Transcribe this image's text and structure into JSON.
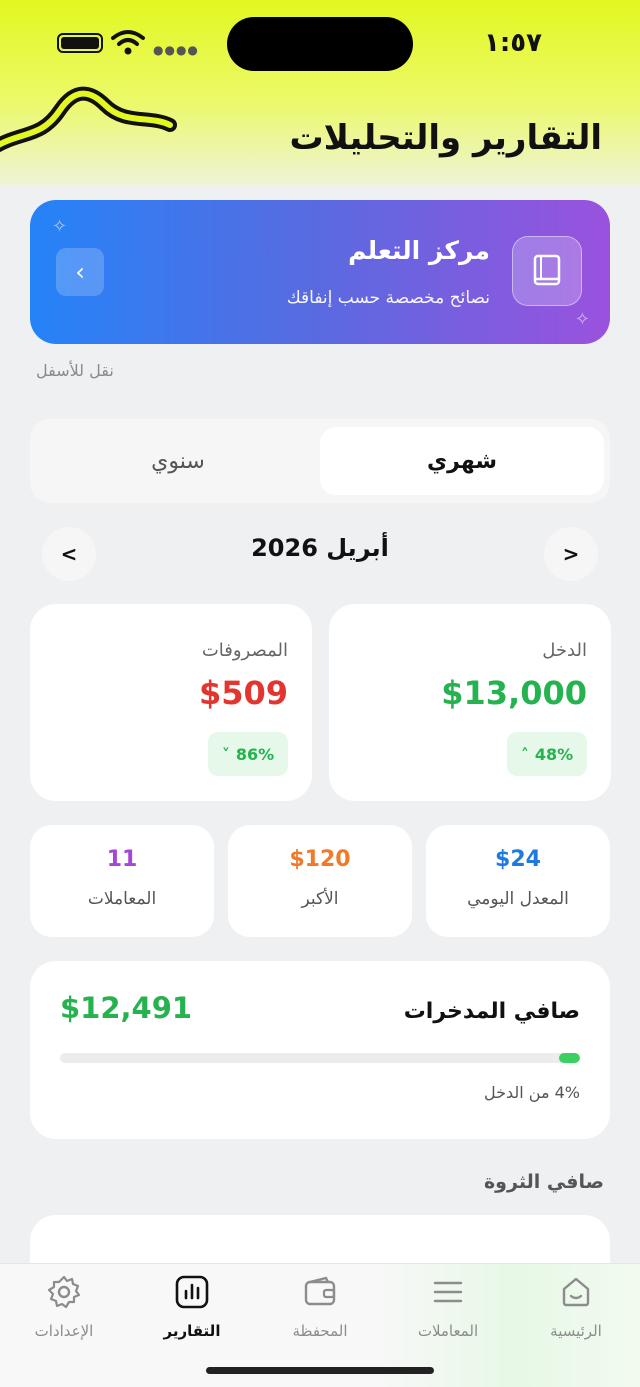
{
  "status_bar": {
    "time": "١:٥٧"
  },
  "page_title": "التقارير والتحليلات",
  "learning_card": {
    "title": "مركز التعلم",
    "subtitle": "نصائح مخصصة حسب إنفاقك"
  },
  "move_down_hint": "نقل للأسفل",
  "period_toggle": {
    "monthly": "شهري",
    "yearly": "سنوي",
    "selected": "monthly"
  },
  "month_nav": {
    "label": "أبريل 2026",
    "prev": "<",
    "next": ">"
  },
  "income": {
    "label": "الدخل",
    "value": "$13,000",
    "badge": "48%",
    "color": "#27b250"
  },
  "expenses": {
    "label": "المصروفات",
    "value": "$509",
    "badge": "86%",
    "color": "#e3342f"
  },
  "mini_stats": [
    {
      "label": "المعدل اليومي",
      "value": "$24",
      "color": "#1f7ae0"
    },
    {
      "label": "الأكبر",
      "value": "$120",
      "color": "#f07a2a"
    },
    {
      "label": "المعاملات",
      "value": "11",
      "color": "#a646d6"
    }
  ],
  "net_savings": {
    "title": "صافي المدخرات",
    "value": "$12,491",
    "note": "4% من الدخل",
    "progress": 0.04
  },
  "net_worth_heading": "صافي الثروة",
  "tabbar": [
    {
      "label": "الرئيسية",
      "icon": "home-icon",
      "active": false
    },
    {
      "label": "المعاملات",
      "icon": "list-icon",
      "active": false
    },
    {
      "label": "المحفظة",
      "icon": "wallet-icon",
      "active": false
    },
    {
      "label": "التقارير",
      "icon": "chart-icon",
      "active": true
    },
    {
      "label": "الإعدادات",
      "icon": "gear-icon",
      "active": false
    }
  ]
}
